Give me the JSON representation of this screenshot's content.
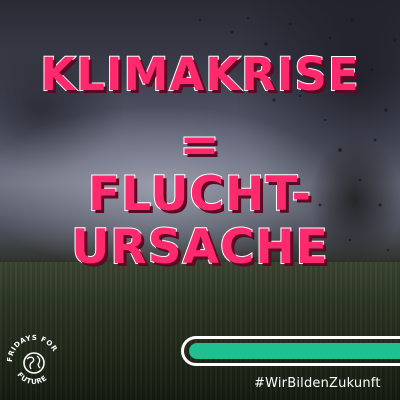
{
  "headline": {
    "line1": "KLIMAKRISE",
    "line2": "=",
    "line3": "FLUCHT-",
    "line4": "URSACHE"
  },
  "logo": {
    "name": "fridays-for-future-logo",
    "text": "FRIDAYS FOR FUTURE"
  },
  "hashtag": "#WirBildenZukunft",
  "colors": {
    "headline_fill": "#ff2a6d",
    "headline_outline": "#ffffff",
    "thermometer_fill": "#1fbf8f",
    "sky": "#55586a",
    "grass": "#2b3523"
  },
  "icons": [
    "earth-globe-icon",
    "thermometer-icon"
  ]
}
